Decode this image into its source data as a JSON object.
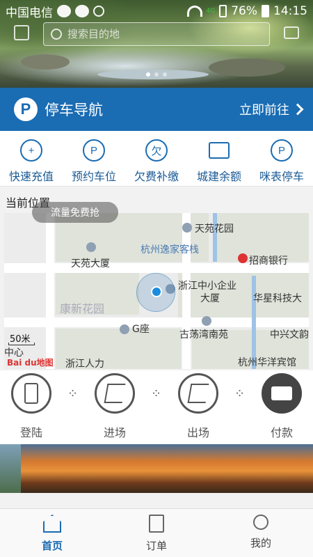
{
  "statusbar": {
    "carrier": "中国电信",
    "battery": "76%",
    "time": "14:15",
    "network": "4G"
  },
  "search": {
    "placeholder": "搜索目的地"
  },
  "nav": {
    "title": "停车导航",
    "go": "立即前往",
    "icon": "P"
  },
  "quick": [
    {
      "label": "快速充值",
      "icon": "recharge-icon",
      "glyph": "+"
    },
    {
      "label": "预约车位",
      "icon": "reserve-icon",
      "glyph": "P"
    },
    {
      "label": "欠费补缴",
      "icon": "arrears-icon",
      "glyph": "欠"
    },
    {
      "label": "城建余额",
      "icon": "balance-card-icon",
      "glyph": "▭"
    },
    {
      "label": "咪表停车",
      "icon": "meter-parking-icon",
      "glyph": "P"
    }
  ],
  "location": {
    "title": "当前位置",
    "flow_button": "流量免费抢",
    "scale": "50米",
    "brand": "Bai du地图",
    "labels": [
      "天苑花园",
      "天苑大厦",
      "杭州逸家客栈",
      "招商银行",
      "浙江中小企业",
      "大厦",
      "华星科技大",
      "康新花园",
      "G座",
      "古荡湾南苑",
      "中兴文韵",
      "浙江人力",
      "杭州华洋宾馆",
      "中心"
    ]
  },
  "steps": [
    {
      "label": "登陆",
      "icon": "phone-icon"
    },
    {
      "label": "进场",
      "icon": "car-enter-icon"
    },
    {
      "label": "出场",
      "icon": "car-exit-icon"
    },
    {
      "label": "付款",
      "icon": "payment-card-icon"
    }
  ],
  "tabs": [
    {
      "label": "首页",
      "icon": "home-icon",
      "active": true
    },
    {
      "label": "订单",
      "icon": "order-doc-icon",
      "active": false
    },
    {
      "label": "我的",
      "icon": "profile-icon",
      "active": false
    }
  ],
  "colors": {
    "primary": "#1a6cb3",
    "quick_text": "#1a5a94"
  }
}
